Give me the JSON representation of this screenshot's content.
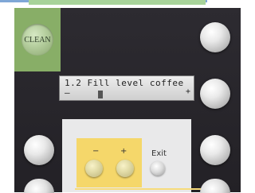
{
  "clean_button": {
    "label": "CLEAN"
  },
  "display": {
    "line1": "1.2 Fill level coffee",
    "minus": "–",
    "plus": "+",
    "fill_level_fraction": 0.25
  },
  "controls": {
    "minus_label": "−",
    "plus_label": "+",
    "exit_label": "Exit"
  },
  "colors": {
    "clean_highlight": "#8db56a",
    "adjust_highlight": "#f5d76a",
    "panel": "#2a282d"
  }
}
